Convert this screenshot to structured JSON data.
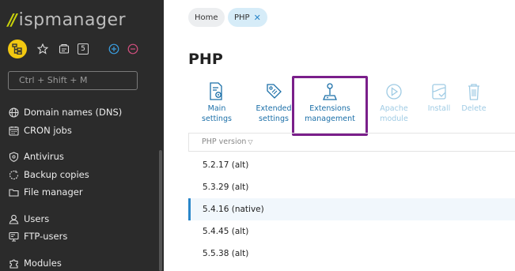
{
  "brand": {
    "logo_text": "ispmanager",
    "logo_mark": "//"
  },
  "sidebar": {
    "toolbar": {
      "counter": "5"
    },
    "search_placeholder": "Ctrl + Shift + M",
    "items": [
      {
        "label": "Domain names (DNS)",
        "icon": "globe-icon"
      },
      {
        "label": "CRON jobs",
        "icon": "calendar-icon"
      },
      {
        "label": "Antivirus",
        "icon": "shield-icon"
      },
      {
        "label": "Backup copies",
        "icon": "backup-icon"
      },
      {
        "label": "File manager",
        "icon": "folder-icon"
      },
      {
        "label": "Users",
        "icon": "user-icon"
      },
      {
        "label": "FTP-users",
        "icon": "ftp-icon"
      },
      {
        "label": "Modules",
        "icon": "puzzle-icon"
      }
    ]
  },
  "breadcrumbs": [
    {
      "label": "Home"
    },
    {
      "label": "PHP",
      "close": "✕"
    }
  ],
  "page": {
    "title": "PHP"
  },
  "actions": [
    {
      "label_line1": "Main",
      "label_line2": "settings",
      "enabled": true
    },
    {
      "label_line1": "Extended",
      "label_line2": "settings",
      "enabled": true
    },
    {
      "label_line1": "Extensions",
      "label_line2": "management",
      "enabled": true
    },
    {
      "label_line1": "Apache",
      "label_line2": "module",
      "enabled": false
    },
    {
      "label_line1": "Install",
      "label_line2": "",
      "enabled": false
    },
    {
      "label_line1": "Delete",
      "label_line2": "",
      "enabled": false
    }
  ],
  "table": {
    "column_header": "PHP version",
    "sort_indicator": "▽",
    "rows": [
      {
        "version": "5.2.17 (alt)"
      },
      {
        "version": "5.3.29 (alt)"
      },
      {
        "version": "5.4.16 (native)",
        "selected": true
      },
      {
        "version": "5.4.45 (alt)"
      },
      {
        "version": "5.5.38 (alt)"
      }
    ]
  },
  "colors": {
    "sidebar_bg": "#2b2b2b",
    "accent": "#2a86c9",
    "highlight_border": "#7a1f8a",
    "logo_mark": "#c9d20b",
    "avatar": "#f2c811"
  }
}
